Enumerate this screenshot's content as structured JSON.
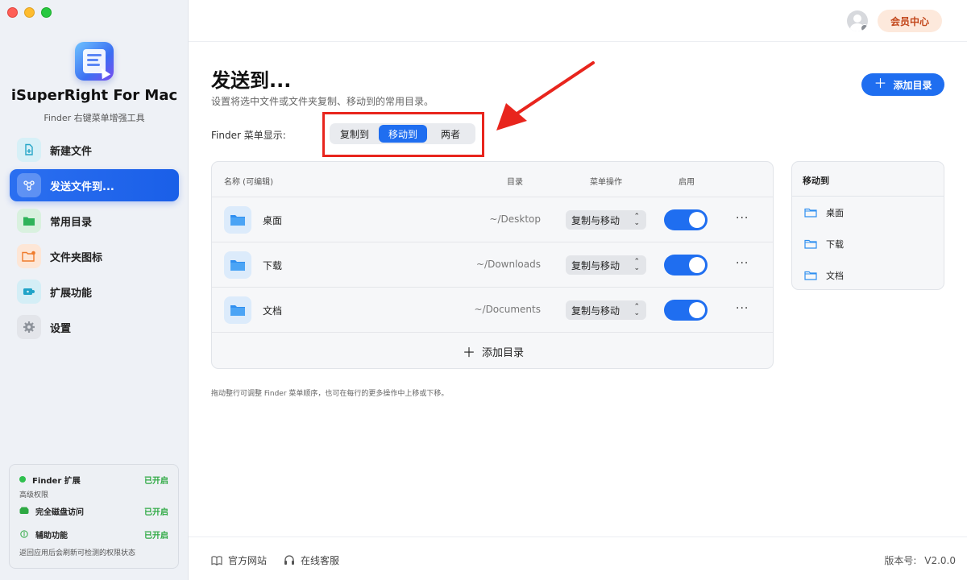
{
  "window": {
    "controls": [
      "close",
      "minimize",
      "zoom"
    ]
  },
  "app": {
    "name": "iSuperRight For Mac",
    "subtitle": "Finder 右键菜单增强工具"
  },
  "sidebar": {
    "items": [
      {
        "label": "新建文件",
        "icon": "new-file-icon",
        "active": false
      },
      {
        "label": "发送文件到...",
        "icon": "share-nodes-icon",
        "active": true
      },
      {
        "label": "常用目录",
        "icon": "folder-icon",
        "active": false
      },
      {
        "label": "文件夹图标",
        "icon": "folder-image-icon",
        "active": false
      },
      {
        "label": "扩展功能",
        "icon": "puzzle-icon",
        "active": false
      },
      {
        "label": "设置",
        "icon": "gear-icon",
        "active": false
      }
    ]
  },
  "permissions": {
    "finder_ext_label": "Finder 扩展",
    "finder_ext_state": "已开启",
    "advanced_label": "高级权限",
    "disk_label": "完全磁盘访问",
    "disk_state": "已开启",
    "a11y_label": "辅助功能",
    "a11y_state": "已开启",
    "footer": "返回应用后会刷新可检测的权限状态"
  },
  "topbar": {
    "member_button": "会员中心"
  },
  "main": {
    "title": "发送到...",
    "description": "设置将选中文件或文件夹复制、移动到的常用目录。",
    "add_button": "添加目录",
    "finder_display_label": "Finder 菜单显示:",
    "segments": [
      "复制到",
      "移动到",
      "两者"
    ],
    "selected_segment": "移动到"
  },
  "table": {
    "headers": {
      "name": "名称 (可编辑)",
      "dir": "目录",
      "op": "菜单操作",
      "enabled": "启用"
    },
    "rows": [
      {
        "name": "桌面",
        "path": "~/Desktop",
        "op": "复制与移动",
        "enabled": true
      },
      {
        "name": "下载",
        "path": "~/Downloads",
        "op": "复制与移动",
        "enabled": true
      },
      {
        "name": "文档",
        "path": "~/Documents",
        "op": "复制与移动",
        "enabled": true
      }
    ],
    "add_row_label": "添加目录"
  },
  "hint": "拖动整行可调整 Finder 菜单顺序，也可在每行的更多操作中上移或下移。",
  "preview": {
    "title": "移动到",
    "items": [
      "桌面",
      "下载",
      "文档"
    ]
  },
  "footer": {
    "website": "官方网站",
    "support": "在线客服",
    "version_label": "版本号:",
    "version": "V2.0.0"
  },
  "colors": {
    "accent": "#1f6ef0",
    "highlight": "#e8251d",
    "enabled_green": "#2ea943",
    "member_text": "#c2461a"
  }
}
